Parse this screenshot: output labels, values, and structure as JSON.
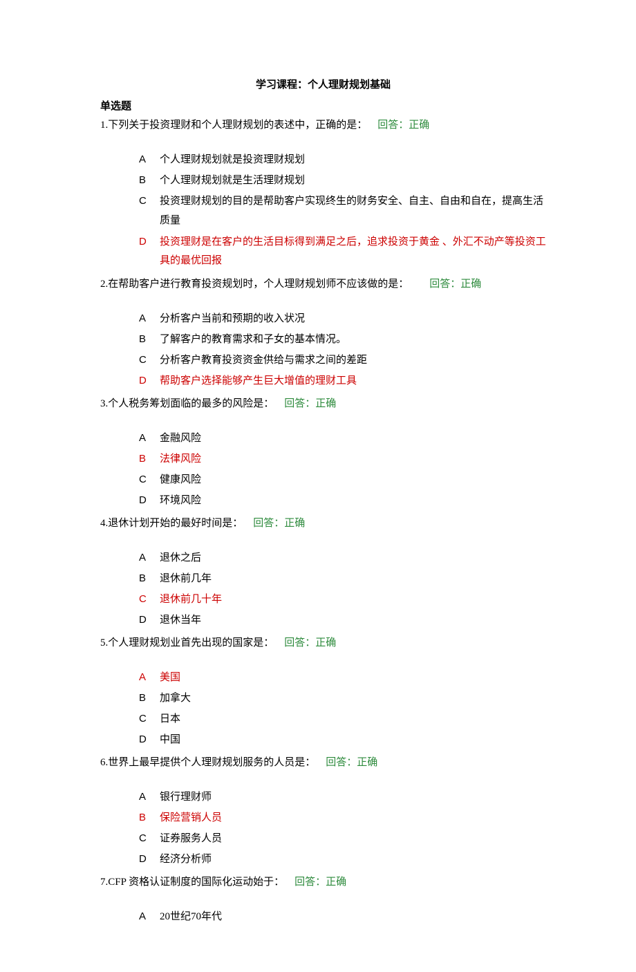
{
  "title": "学习课程：个人理财规划基础",
  "section_heading": "单选题",
  "feedback_label": "回答：正确",
  "questions": [
    {
      "number": "1.",
      "stem": "下列关于投资理财和个人理财规划的表述中，正确的是：",
      "options": [
        {
          "l": "A",
          "t": "个人理财规划就是投资理财规划",
          "correct": false
        },
        {
          "l": "B",
          "t": "个人理财规划就是生活理财规划",
          "correct": false
        },
        {
          "l": "C",
          "t": "投资理财规划的目的是帮助客户实现终生的财务安全、自主、自由和自在，提高生活质量",
          "correct": false
        },
        {
          "l": "D",
          "t": "投资理财是在客户的生活目标得到满足之后，追求投资于黄金 、外汇不动产等投资工具的最优回报",
          "correct": true
        }
      ]
    },
    {
      "number": "2.",
      "stem": "在帮助客户进行教育投资规划时，个人理财规划师不应该做的是：",
      "options": [
        {
          "l": "A",
          "t": "分析客户当前和预期的收入状况",
          "correct": false
        },
        {
          "l": "B",
          "t": "了解客户的教育需求和子女的基本情况。",
          "correct": false
        },
        {
          "l": "C",
          "t": "分析客户教育投资资金供给与需求之间的差距",
          "correct": false
        },
        {
          "l": "D",
          "t": "帮助客户选择能够产生巨大增值的理财工具",
          "correct": true
        }
      ]
    },
    {
      "number": "3.",
      "stem": "个人税务筹划面临的最多的风险是：",
      "options": [
        {
          "l": "A",
          "t": "金融风险",
          "correct": false
        },
        {
          "l": "B",
          "t": "法律风险",
          "correct": true
        },
        {
          "l": "C",
          "t": "健康风险",
          "correct": false
        },
        {
          "l": "D",
          "t": "环境风险",
          "correct": false
        }
      ]
    },
    {
      "number": "4.",
      "stem": "退休计划开始的最好时间是：",
      "options": [
        {
          "l": "A",
          "t": "退休之后",
          "correct": false
        },
        {
          "l": "B",
          "t": "退休前几年",
          "correct": false
        },
        {
          "l": "C",
          "t": "退休前几十年",
          "correct": true
        },
        {
          "l": "D",
          "t": "退休当年",
          "correct": false
        }
      ]
    },
    {
      "number": "5.",
      "stem": "个人理财规划业首先出现的国家是：",
      "options": [
        {
          "l": "A",
          "t": "美国",
          "correct": true
        },
        {
          "l": "B",
          "t": "加拿大",
          "correct": false
        },
        {
          "l": "C",
          "t": "日本",
          "correct": false
        },
        {
          "l": "D",
          "t": "中国",
          "correct": false
        }
      ]
    },
    {
      "number": "6.",
      "stem": "世界上最早提供个人理财规划服务的人员是：",
      "options": [
        {
          "l": "A",
          "t": "银行理财师",
          "correct": false
        },
        {
          "l": "B",
          "t": "保险营销人员",
          "correct": true
        },
        {
          "l": "C",
          "t": "证券服务人员",
          "correct": false
        },
        {
          "l": "D",
          "t": "经济分析师",
          "correct": false
        }
      ]
    },
    {
      "number": "7.",
      "stem": "CFP 资格认证制度的国际化运动始于：",
      "options": [
        {
          "l": "A",
          "t": "20世纪70年代",
          "correct": false
        }
      ]
    }
  ]
}
